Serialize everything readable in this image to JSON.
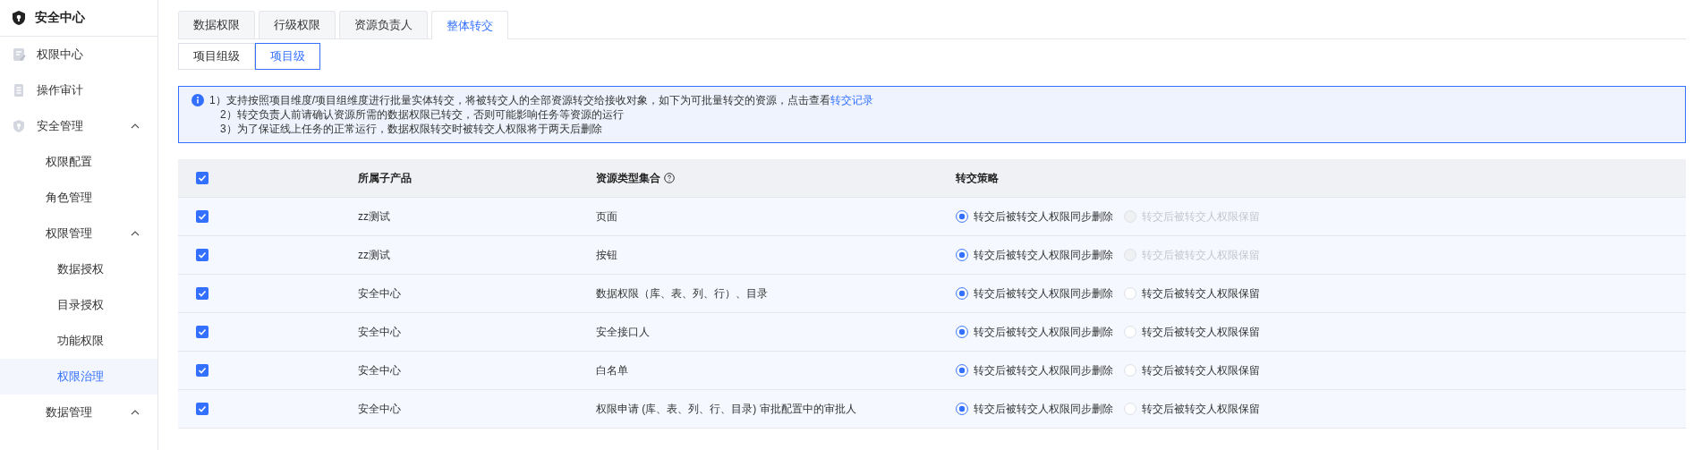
{
  "sidebar": {
    "title": "安全中心",
    "items": [
      {
        "label": "权限中心",
        "selected": false
      },
      {
        "label": "操作审计",
        "selected": false
      },
      {
        "label": "安全管理",
        "expanded": true,
        "selected": false,
        "children": [
          {
            "label": "权限配置",
            "selected": false
          },
          {
            "label": "角色管理",
            "selected": false
          },
          {
            "label": "权限管理",
            "expanded": true,
            "selected": false,
            "children": [
              {
                "label": "数据授权",
                "selected": false
              },
              {
                "label": "目录授权",
                "selected": false
              },
              {
                "label": "功能权限",
                "selected": false
              },
              {
                "label": "权限治理",
                "selected": true
              }
            ]
          },
          {
            "label": "数据管理",
            "expanded": true,
            "selected": false
          }
        ]
      }
    ]
  },
  "tabs": [
    {
      "label": "数据权限",
      "selected": false
    },
    {
      "label": "行级权限",
      "selected": false
    },
    {
      "label": "资源负责人",
      "selected": false
    },
    {
      "label": "整体转交",
      "selected": true
    }
  ],
  "sub_tabs": [
    {
      "label": "项目组级",
      "selected": false
    },
    {
      "label": "项目级",
      "selected": true
    }
  ],
  "notice": {
    "lines": [
      "1）支持按照项目维度/项目组维度进行批量实体转交，将被转交人的全部资源转交给接收对象，如下为可批量转交的资源，点击查看",
      "2）转交负责人前请确认资源所需的数据权限已转交，否则可能影响任务等资源的运行",
      "3）为了保证线上任务的正常运行，数据权限转交时被转交人权限将于两天后删除"
    ],
    "link": "转交记录"
  },
  "table": {
    "select_all_checked": true,
    "columns": [
      "所属子产品",
      "资源类型集合",
      "转交策略"
    ],
    "rows": [
      {
        "checked": true,
        "product": "zz测试",
        "resource": "页面",
        "options": [
          {
            "label": "转交后被转交人权限同步删除",
            "selected": true,
            "disabled": false
          },
          {
            "label": "转交后被转交人权限保留",
            "selected": false,
            "disabled": true
          }
        ]
      },
      {
        "checked": true,
        "product": "zz测试",
        "resource": "按钮",
        "options": [
          {
            "label": "转交后被转交人权限同步删除",
            "selected": true,
            "disabled": false
          },
          {
            "label": "转交后被转交人权限保留",
            "selected": false,
            "disabled": true
          }
        ]
      },
      {
        "checked": true,
        "product": "安全中心",
        "resource": "数据权限（库、表、列、行）、目录",
        "options": [
          {
            "label": "转交后被转交人权限同步删除",
            "selected": true,
            "disabled": false
          },
          {
            "label": "转交后被转交人权限保留",
            "selected": false,
            "disabled": false
          }
        ]
      },
      {
        "checked": true,
        "product": "安全中心",
        "resource": "安全接口人",
        "options": [
          {
            "label": "转交后被转交人权限同步删除",
            "selected": true,
            "disabled": false
          },
          {
            "label": "转交后被转交人权限保留",
            "selected": false,
            "disabled": false
          }
        ]
      },
      {
        "checked": true,
        "product": "安全中心",
        "resource": "白名单",
        "options": [
          {
            "label": "转交后被转交人权限同步删除",
            "selected": true,
            "disabled": false
          },
          {
            "label": "转交后被转交人权限保留",
            "selected": false,
            "disabled": false
          }
        ]
      },
      {
        "checked": true,
        "product": "安全中心",
        "resource": "权限申请 (库、表、列、行、目录) 审批配置中的审批人",
        "options": [
          {
            "label": "转交后被转交人权限同步删除",
            "selected": true,
            "disabled": false
          },
          {
            "label": "转交后被转交人权限保留",
            "selected": false,
            "disabled": false
          }
        ]
      }
    ]
  }
}
